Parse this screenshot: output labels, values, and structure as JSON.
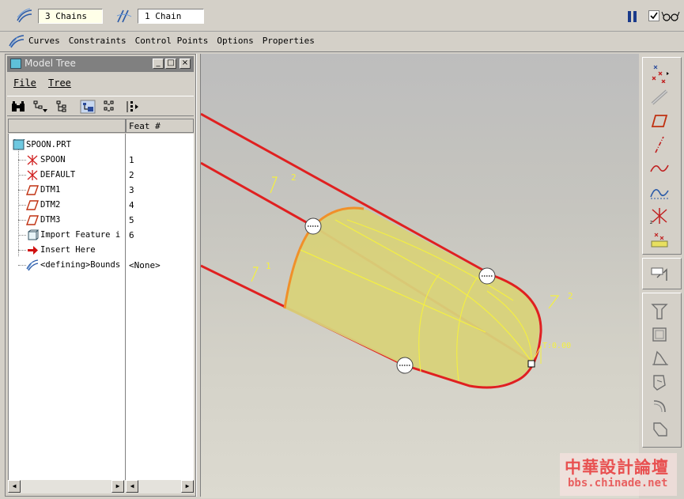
{
  "dashboard": {
    "chain_field_1": "3 Chains",
    "chain_field_2": "1 Chain",
    "preview_checked": true
  },
  "menu": {
    "items": [
      "Curves",
      "Constraints",
      "Control Points",
      "Options",
      "Properties"
    ]
  },
  "model_tree": {
    "title": "Model Tree",
    "window_buttons": [
      "_",
      "□",
      "×"
    ],
    "menu": [
      "File",
      "Tree"
    ],
    "column_header": "Feat #",
    "root": "SPOON.PRT",
    "items": [
      {
        "label": "SPOON",
        "feat": "1",
        "icon": "coord-sys-icon"
      },
      {
        "label": "DEFAULT",
        "feat": "2",
        "icon": "coord-sys-icon"
      },
      {
        "label": "DTM1",
        "feat": "3",
        "icon": "datum-plane-icon"
      },
      {
        "label": "DTM2",
        "feat": "4",
        "icon": "datum-plane-icon"
      },
      {
        "label": "DTM3",
        "feat": "5",
        "icon": "datum-plane-icon"
      },
      {
        "label": "Import Feature i",
        "feat": "6",
        "icon": "import-feature-icon"
      },
      {
        "label": "Insert Here",
        "feat": "",
        "icon": "insert-here-arrow-icon"
      },
      {
        "label": "<defining>Bounds",
        "feat": "<None>",
        "icon": "boundary-blend-icon"
      }
    ]
  },
  "viewport": {
    "labels": {
      "chain_1": "1",
      "chain_2_top": "2",
      "chain_2_right": "2",
      "tangency": "T:0.00"
    }
  },
  "watermark": {
    "line1": "中華設計論壇",
    "line2": "bbs.chinade.net"
  },
  "colors": {
    "background": "#d4d0c8",
    "curve_red": "#e02020",
    "surface_yellow": "#d8d27a",
    "highlight_orange": "#f0902a",
    "pause_blue": "#1a3a8a"
  }
}
